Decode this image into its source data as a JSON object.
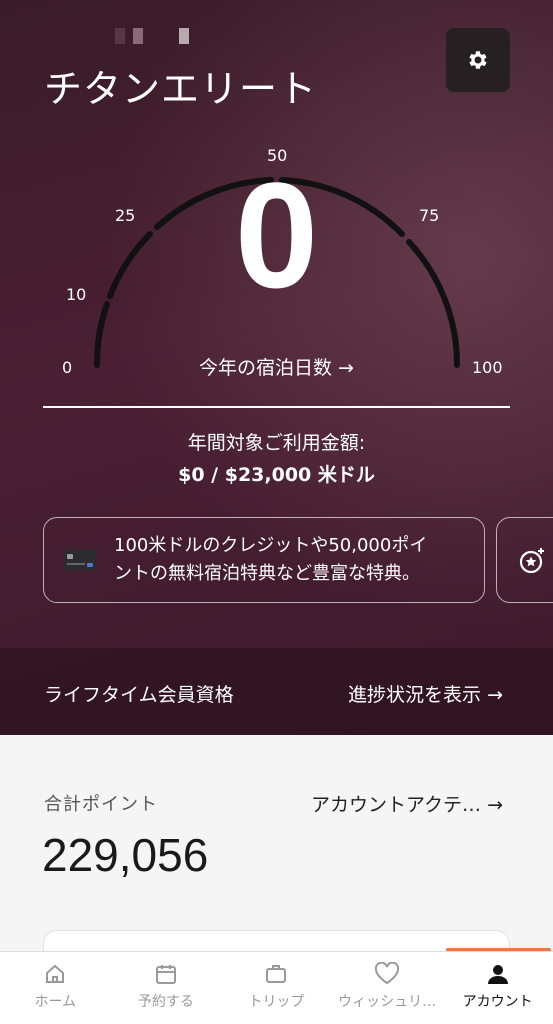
{
  "header": {
    "title": "チタンエリート",
    "settings_icon": "gear-icon"
  },
  "gauge": {
    "value": "0",
    "ticks": [
      "0",
      "10",
      "25",
      "50",
      "75",
      "100"
    ],
    "nights_link": "今年の宿泊日数 →"
  },
  "spend": {
    "label": "年間対象ご利用金額:",
    "value": "$0 / $23,000 米ドル"
  },
  "benefit_card": {
    "icon": "credit-card-icon",
    "line1": "100米ドルのクレジットや50,000ポイ",
    "line2": "ントの無料宿泊特典など豊富な特典。",
    "next_card_icon": "star-badge-icon"
  },
  "lifetime": {
    "label": "ライフタイム会員資格",
    "link": "進捗状況を表示 →"
  },
  "points": {
    "label": "合計ポイント",
    "value": "229,056",
    "activity_link": "アカウントアクテ… →"
  },
  "tabs": [
    {
      "label": "ホーム",
      "icon": "home-icon"
    },
    {
      "label": "予約する",
      "icon": "calendar-icon"
    },
    {
      "label": "トリップ",
      "icon": "suitcase-icon"
    },
    {
      "label": "ウィッシュリ…",
      "icon": "heart-icon"
    },
    {
      "label": "アカウント",
      "icon": "person-icon"
    }
  ],
  "colors": {
    "hero_bg": "#4a1f33",
    "tab_indicator": "#e87a3a"
  }
}
